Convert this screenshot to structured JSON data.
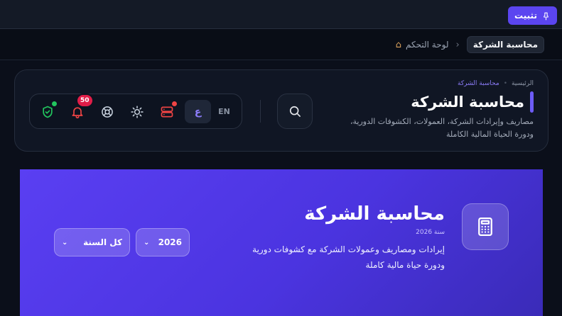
{
  "topbar": {
    "pin_label": "تثبيت"
  },
  "breadcrumb": {
    "home_label": "لوحة التحكم",
    "current_label": "محاسبة الشركة"
  },
  "header": {
    "mini_breadcrumb": {
      "home": "الرئيسية",
      "current": "محاسبة الشركة"
    },
    "title": "محاسبة الشركة",
    "description_line1": "مصاريف وإيرادات الشركة، العمولات، الكشوفات الدورية،",
    "description_line2": "ودورة الحياة المالية الكاملة"
  },
  "toolbar": {
    "lang_en": "EN",
    "lang_ar": "ع",
    "notification_count": "50"
  },
  "hero": {
    "title": "محاسبة الشركة",
    "year_label": "سنة 2026",
    "description_line1": "إيرادات ومصاريف وعمولات الشركة مع كشوفات دورية",
    "description_line2": "ودورة حياة مالية كاملة",
    "year_select_value": "2026",
    "period_select_value": "كل السنة"
  },
  "colors": {
    "accent": "#6d5cf6",
    "hero_gradient_start": "#5a3ff2",
    "hero_gradient_end": "#3a2bb8",
    "danger": "#ef4444",
    "success": "#22c55e"
  },
  "icons": [
    "pin-icon",
    "home-icon",
    "chevron-left-icon",
    "search-icon",
    "server-icon",
    "sun-icon",
    "lifebuoy-icon",
    "bell-icon",
    "shield-check-icon",
    "calculator-icon",
    "chevron-down-icon"
  ]
}
